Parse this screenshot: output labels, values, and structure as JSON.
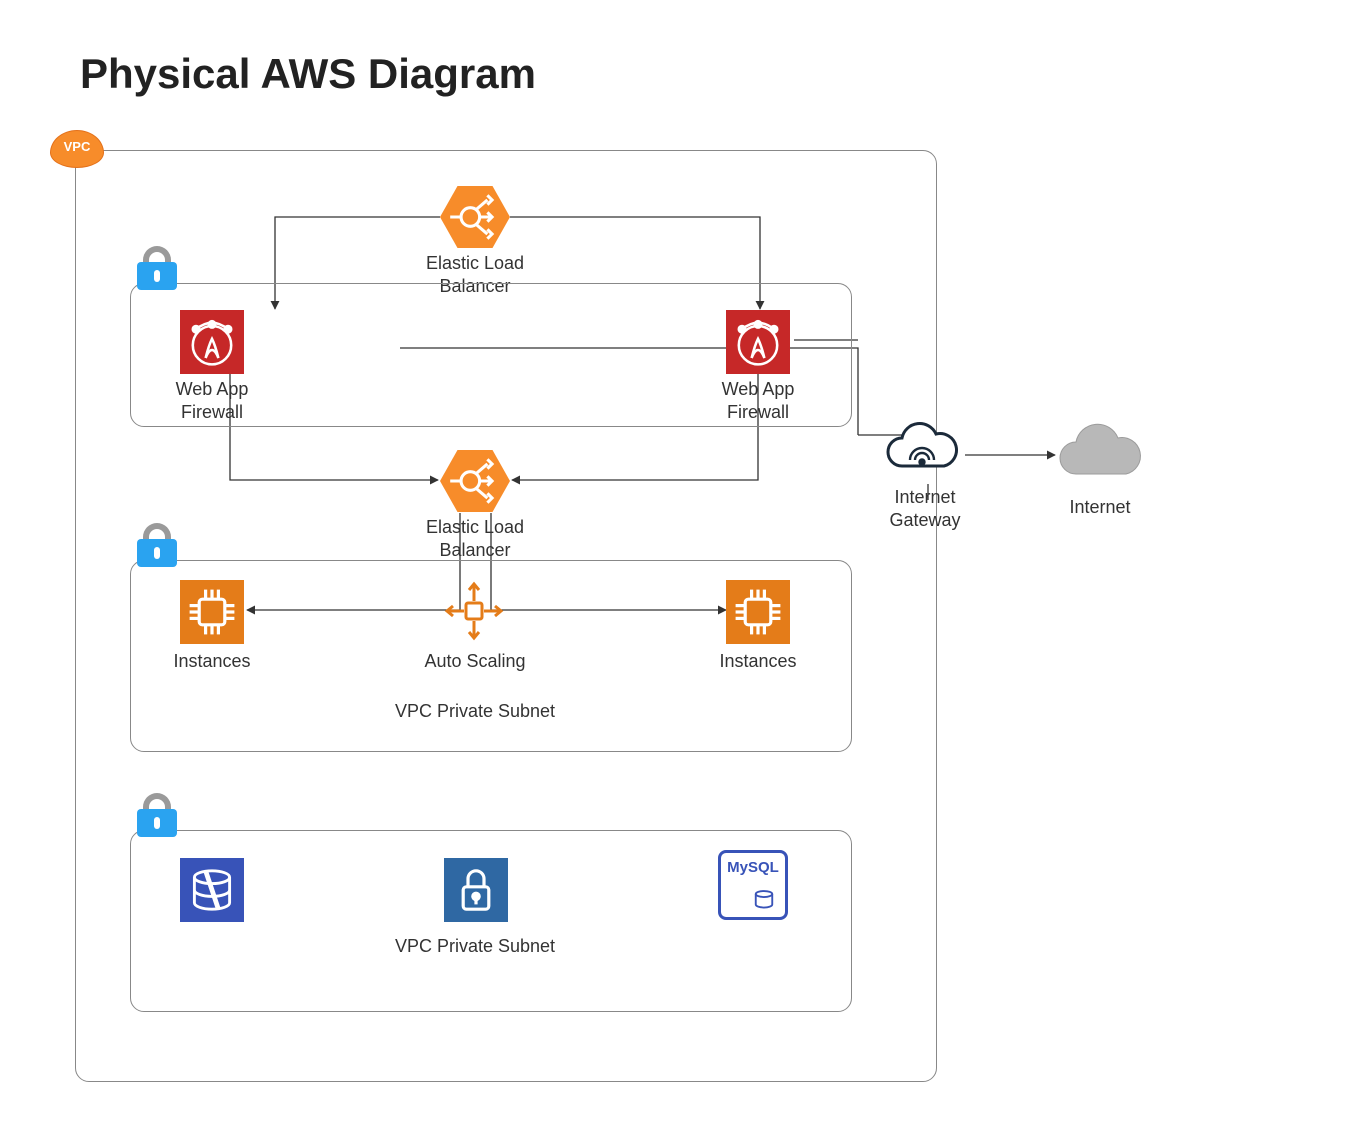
{
  "title": "Physical AWS Diagram",
  "vpc_badge": "VPC",
  "elb_top": "Elastic Load Balancer",
  "elb_mid": "Elastic Load Balancer",
  "waf_left": "Web App Firewall",
  "waf_right": "Web App Firewall",
  "instances_left": "Instances",
  "instances_right": "Instances",
  "auto_scaling": "Auto Scaling",
  "subnet_mid": "VPC Private Subnet",
  "subnet_bot": "VPC Private Subnet",
  "mysql": "MySQL",
  "internet_gateway": "Internet Gateway",
  "internet": "Internet"
}
